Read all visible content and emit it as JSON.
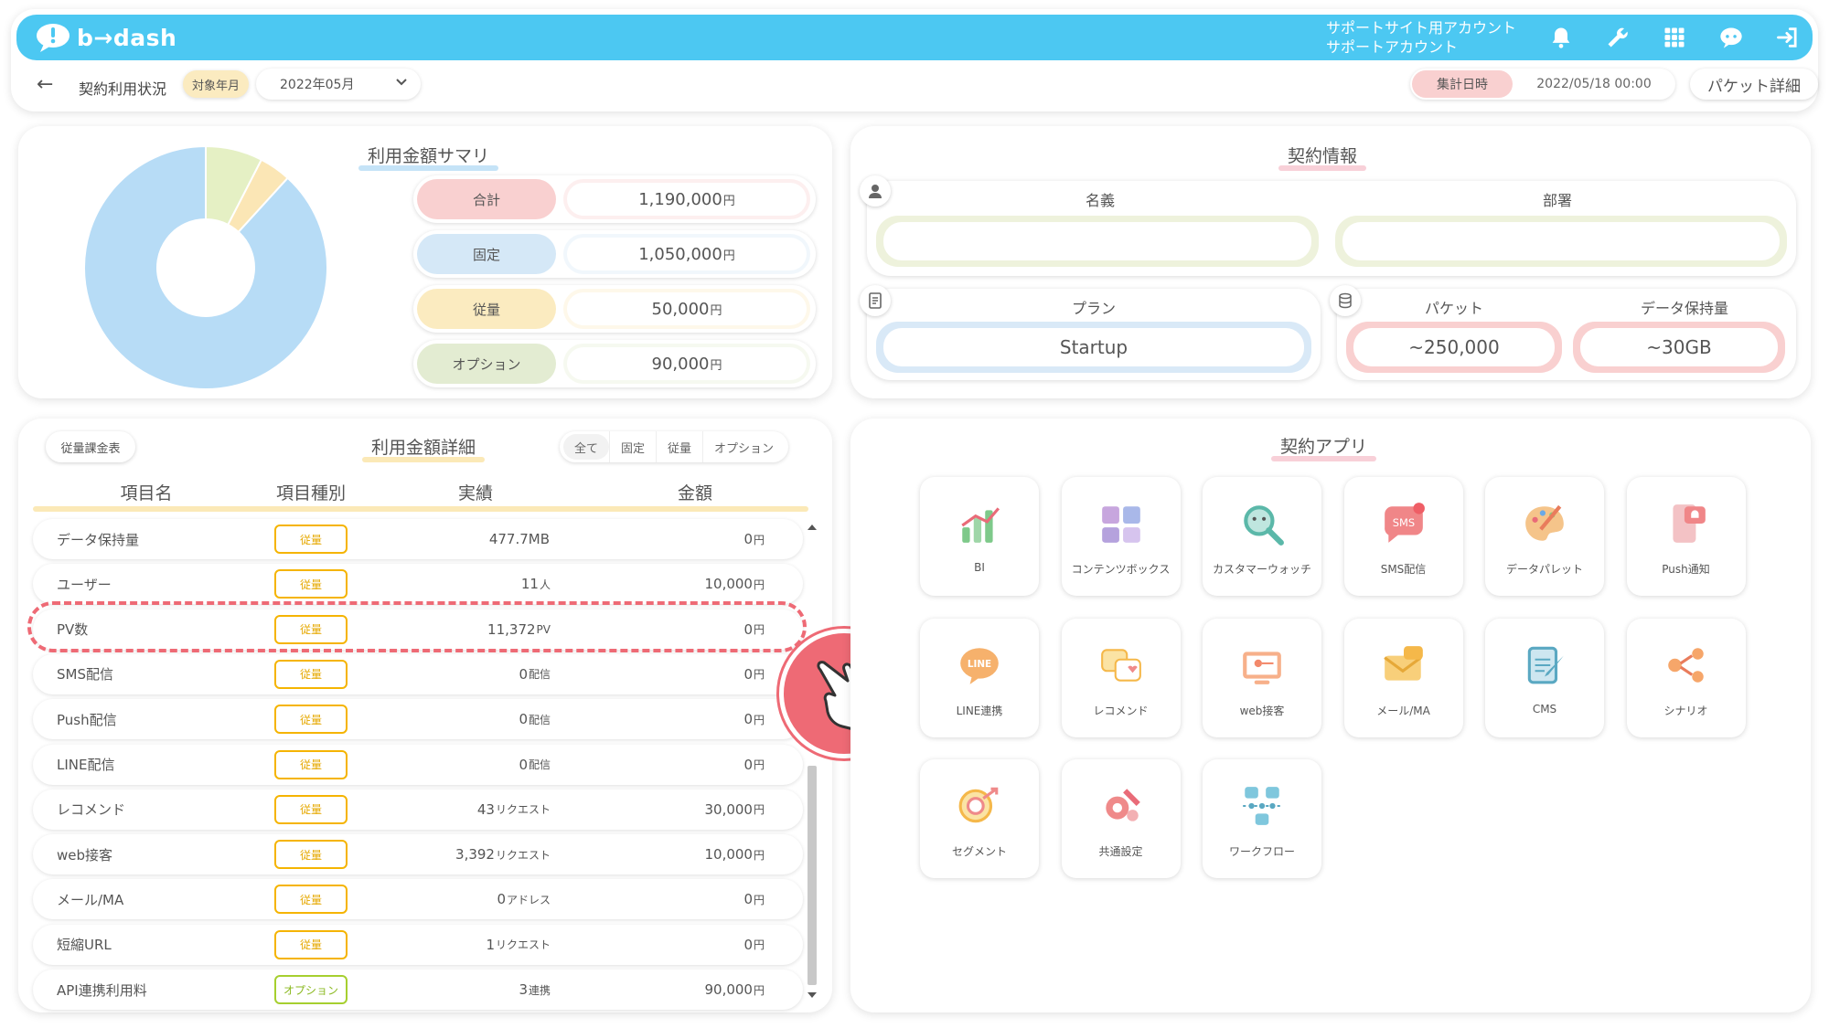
{
  "header": {
    "logo": "b→dash",
    "account_line1": "サポートサイト用アカウント",
    "account_line2": "サポートアカウント",
    "icons": [
      "bell-icon",
      "wrench-icon",
      "grid-icon",
      "chat-bot-icon",
      "logout-icon"
    ]
  },
  "subbar": {
    "back": "←",
    "title": "契約利用状況",
    "period_label": "対象年月",
    "period_value": "2022年05月",
    "agg_label": "集計日時",
    "agg_value": "2022/05/18 00:00",
    "packet_button": "パケット詳細"
  },
  "summary": {
    "title": "利用金額サマリ",
    "rows": [
      {
        "label": "合計",
        "value": "1,190,000",
        "unit": "円",
        "color": "#f9d0d0"
      },
      {
        "label": "固定",
        "value": "1,050,000",
        "unit": "円",
        "color": "#d5e8f7"
      },
      {
        "label": "従量",
        "value": "50,000",
        "unit": "円",
        "color": "#fbebc0"
      },
      {
        "label": "オプション",
        "value": "90,000",
        "unit": "円",
        "color": "#e3ecd2"
      }
    ]
  },
  "chart_data": {
    "type": "pie",
    "categories": [
      "固定",
      "従量",
      "オプション"
    ],
    "values": [
      1050000,
      50000,
      90000
    ],
    "colors": [
      "#b7dcf6",
      "#fbe6b5",
      "#e5f0c4"
    ],
    "donut": true
  },
  "contract": {
    "title": "契約情報",
    "name_label": "名義",
    "name_value": "",
    "dept_label": "部署",
    "dept_value": "",
    "plan_label": "プラン",
    "plan_value": "Startup",
    "packet_label": "パケット",
    "packet_value": "~250,000",
    "storage_label": "データ保持量",
    "storage_value": "~30GB"
  },
  "detail": {
    "title": "利用金額詳細",
    "table_button": "従量課金表",
    "filters": [
      "全て",
      "固定",
      "従量",
      "オプション"
    ],
    "columns": [
      "項目名",
      "項目種別",
      "実績",
      "金額"
    ],
    "rows": [
      {
        "name": "データ保持量",
        "type": "従量",
        "result": "477.7MB",
        "result_unit": "",
        "amount": "0",
        "amount_unit": "円"
      },
      {
        "name": "ユーザー",
        "type": "従量",
        "result": "11",
        "result_unit": "人",
        "amount": "10,000",
        "amount_unit": "円"
      },
      {
        "name": "PV数",
        "type": "従量",
        "result": "11,372",
        "result_unit": "PV",
        "amount": "0",
        "amount_unit": "円"
      },
      {
        "name": "SMS配信",
        "type": "従量",
        "result": "0",
        "result_unit": "配信",
        "amount": "0",
        "amount_unit": "円"
      },
      {
        "name": "Push配信",
        "type": "従量",
        "result": "0",
        "result_unit": "配信",
        "amount": "0",
        "amount_unit": "円"
      },
      {
        "name": "LINE配信",
        "type": "従量",
        "result": "0",
        "result_unit": "配信",
        "amount": "0",
        "amount_unit": "円"
      },
      {
        "name": "レコメンド",
        "type": "従量",
        "result": "43",
        "result_unit": "リクエスト",
        "amount": "30,000",
        "amount_unit": "円"
      },
      {
        "name": "web接客",
        "type": "従量",
        "result": "3,392",
        "result_unit": "リクエスト",
        "amount": "10,000",
        "amount_unit": "円"
      },
      {
        "name": "メール/MA",
        "type": "従量",
        "result": "0",
        "result_unit": "アドレス",
        "amount": "0",
        "amount_unit": "円"
      },
      {
        "name": "短縮URL",
        "type": "従量",
        "result": "1",
        "result_unit": "リクエスト",
        "amount": "0",
        "amount_unit": "円"
      },
      {
        "name": "API連携利用料",
        "type": "オプション",
        "result": "3",
        "result_unit": "連携",
        "amount": "90,000",
        "amount_unit": "円"
      }
    ]
  },
  "apps": {
    "title": "契約アプリ",
    "items": [
      {
        "label": "BI",
        "icon": "bi-chart-icon"
      },
      {
        "label": "コンテンツボックス",
        "icon": "content-box-icon"
      },
      {
        "label": "カスタマーウォッチ",
        "icon": "customer-watch-icon"
      },
      {
        "label": "SMS配信",
        "icon": "sms-icon"
      },
      {
        "label": "データパレット",
        "icon": "data-palette-icon"
      },
      {
        "label": "Push通知",
        "icon": "push-notification-icon"
      },
      {
        "label": "LINE連携",
        "icon": "line-icon"
      },
      {
        "label": "レコメンド",
        "icon": "recommend-icon"
      },
      {
        "label": "web接客",
        "icon": "web-service-icon"
      },
      {
        "label": "メール/MA",
        "icon": "mail-icon"
      },
      {
        "label": "CMS",
        "icon": "cms-icon"
      },
      {
        "label": "シナリオ",
        "icon": "scenario-icon"
      },
      {
        "label": "セグメント",
        "icon": "segment-icon"
      },
      {
        "label": "共通設定",
        "icon": "settings-icon"
      },
      {
        "label": "ワークフロー",
        "icon": "workflow-icon"
      }
    ]
  }
}
